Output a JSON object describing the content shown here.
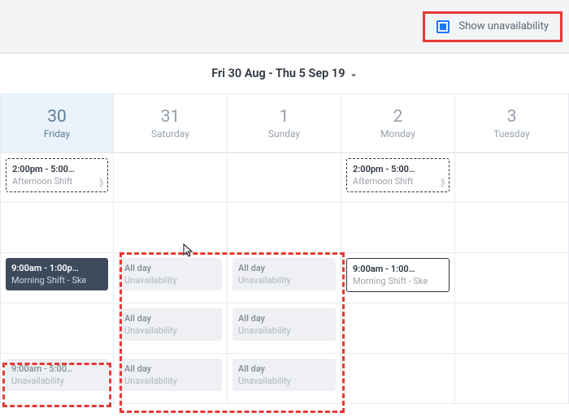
{
  "toolbar": {
    "show_unavailability_label": "Show unavailability"
  },
  "dateRange": "Fri 30 Aug - Thu 5 Sep 19",
  "days": [
    {
      "num": "30",
      "dow": "Friday",
      "active": true
    },
    {
      "num": "31",
      "dow": "Saturday",
      "active": false
    },
    {
      "num": "1",
      "dow": "Sunday",
      "active": false
    },
    {
      "num": "2",
      "dow": "Monday",
      "active": false
    },
    {
      "num": "3",
      "dow": "Tuesday",
      "active": false
    }
  ],
  "rows": [
    [
      {
        "time": "2:00pm - 5:00…",
        "label": "Afternoon Shift",
        "style": "dashed",
        "arrow": true
      },
      null,
      null,
      {
        "time": "2:00pm - 5:00…",
        "label": "Afternoon Shift",
        "style": "dashed",
        "arrow": true
      },
      null
    ],
    [
      null,
      null,
      null,
      null,
      null
    ],
    [
      {
        "time": "9:00am - 1:00p…",
        "label": "Morning Shift - Ske",
        "style": "dark"
      },
      {
        "time": "All day",
        "label": "Unavailability",
        "style": "gray"
      },
      {
        "time": "All day",
        "label": "Unavailability",
        "style": "gray"
      },
      {
        "time": "9:00am - 1:00…",
        "label": "Morning Shift - Ske",
        "style": "solid"
      },
      null
    ],
    [
      null,
      {
        "time": "All day",
        "label": "Unavailability",
        "style": "gray"
      },
      {
        "time": "All day",
        "label": "Unavailability",
        "style": "gray"
      },
      null,
      null
    ],
    [
      {
        "time": "9:00am - 5:00…",
        "label": "Unavailability",
        "style": "gray"
      },
      {
        "time": "All day",
        "label": "Unavailability",
        "style": "gray"
      },
      {
        "time": "All day",
        "label": "Unavailability",
        "style": "gray"
      },
      null,
      null
    ]
  ]
}
